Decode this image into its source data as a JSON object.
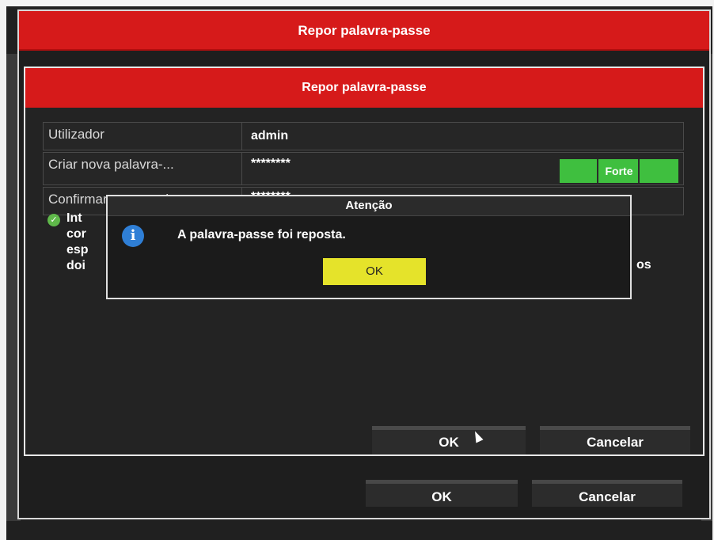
{
  "outer_dialog": {
    "title": "Repor palavra-passe",
    "ok_label": "OK",
    "cancel_label": "Cancelar"
  },
  "inner_dialog": {
    "title": "Repor palavra-passe",
    "fields": [
      {
        "label": "Utilizador",
        "value": "admin"
      },
      {
        "label": "Criar nova palavra-...",
        "value": "********",
        "strength": "Forte"
      },
      {
        "label": "Confirmar password",
        "value": "********"
      }
    ],
    "hint_visible_start": "Int\ncor\nesp\ndoi",
    "hint_visible_end": "os",
    "ok_label": "OK",
    "cancel_label": "Cancelar"
  },
  "alert": {
    "title": "Atenção",
    "message": "A palavra-passe foi reposta.",
    "ok_label": "OK",
    "icon": "info-icon"
  },
  "colors": {
    "title_bar_red": "#d61a1a",
    "strength_green": "#3fbf3f",
    "ok_highlight_yellow": "#e5e32a"
  }
}
